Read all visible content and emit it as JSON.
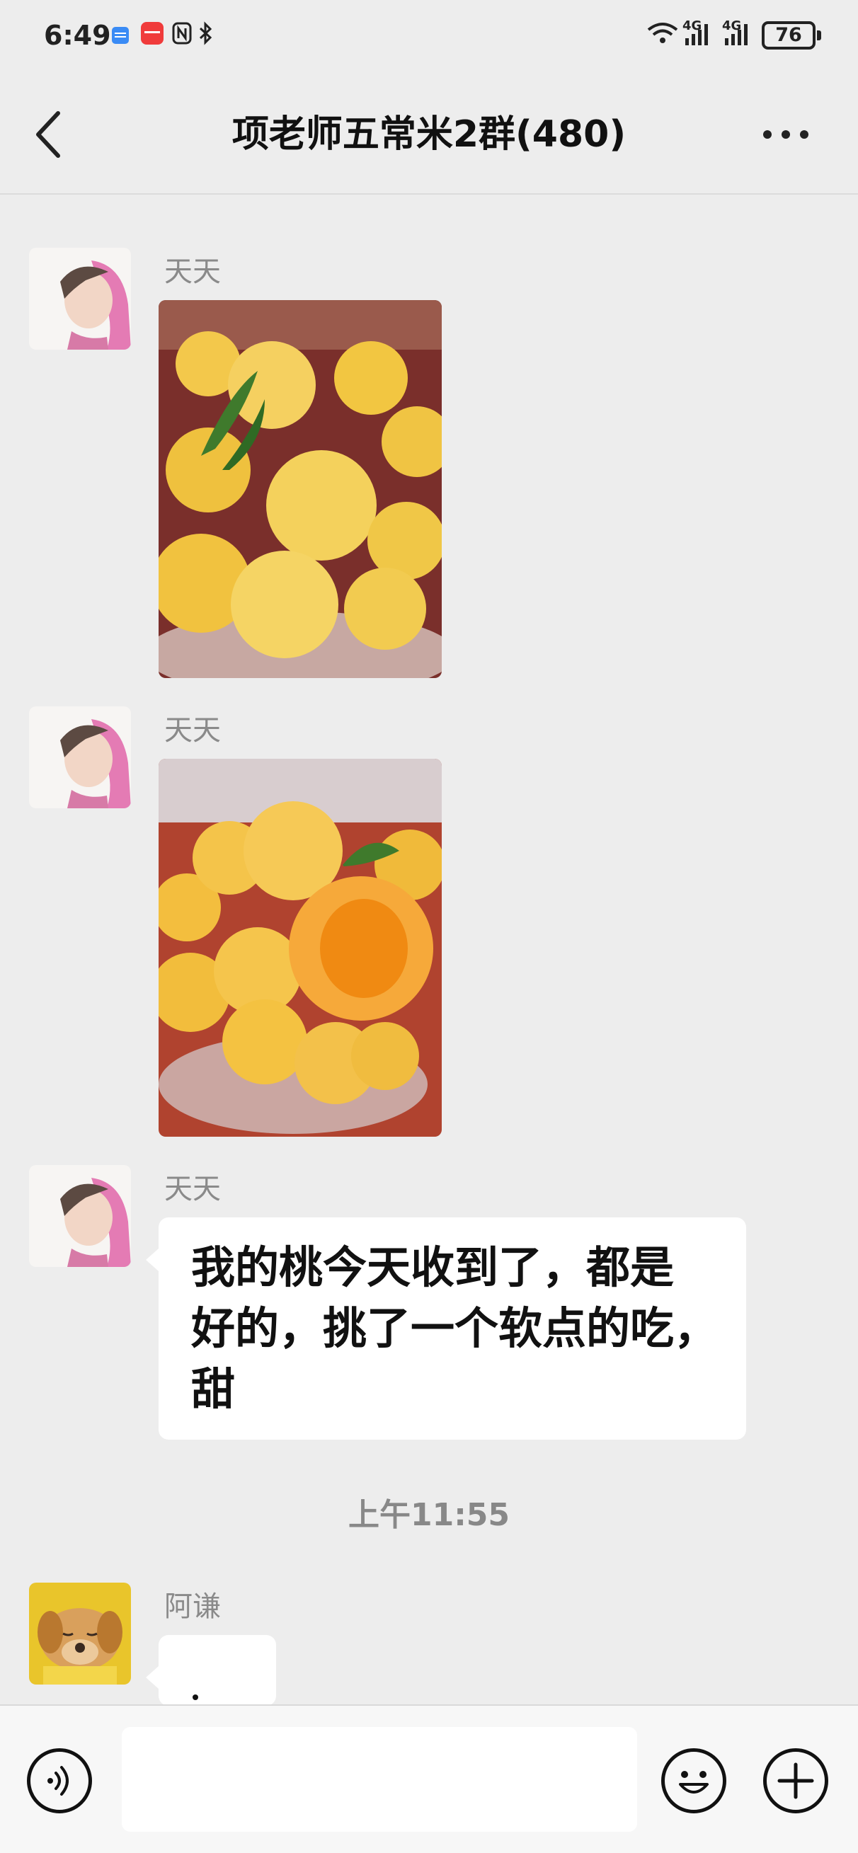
{
  "status_bar": {
    "time": "6:49",
    "signal_1_label": "4G",
    "signal_2_label": "4G",
    "battery": "76"
  },
  "header": {
    "title": "项老师五常米2群(480)"
  },
  "messages": [
    {
      "sender": "天天",
      "type": "image",
      "image_desc": "yellow peaches with leaves"
    },
    {
      "sender": "天天",
      "type": "image",
      "image_desc": "yellow peaches, one bitten"
    },
    {
      "sender": "天天",
      "type": "text",
      "text_lines": [
        "我的桃今天收到了，都是",
        "好的，挑了一个软点的吃，",
        "甜"
      ]
    },
    {
      "sender": "阿谦",
      "type": "text",
      "text_lines": []
    }
  ],
  "timestamp": "上午11:55",
  "input_bar": {
    "placeholder": ""
  },
  "colors": {
    "background": "#ededed",
    "bubble": "#ffffff",
    "peach": "#f5c84a",
    "sender_gray": "#8a8a8a"
  }
}
